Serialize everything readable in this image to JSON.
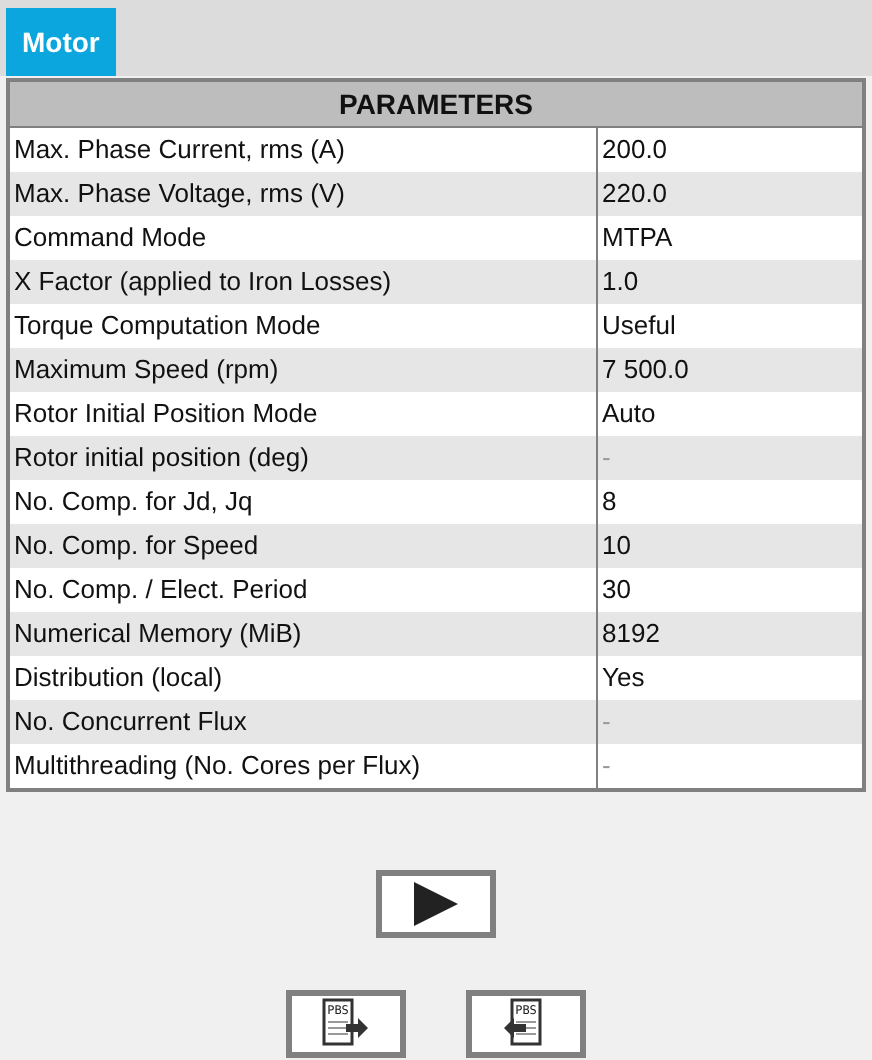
{
  "tabs": [
    {
      "label": "Motor",
      "selected": true
    }
  ],
  "table": {
    "title": "PARAMETERS",
    "rows": [
      {
        "label": "Max. Phase Current, rms (A)",
        "value": "200.0",
        "disabled": false
      },
      {
        "label": "Max. Phase Voltage, rms (V)",
        "value": "220.0",
        "disabled": false
      },
      {
        "label": "Command Mode",
        "value": "MTPA",
        "disabled": false
      },
      {
        "label": "X Factor (applied to Iron Losses)",
        "value": "1.0",
        "disabled": false
      },
      {
        "label": "Torque Computation Mode",
        "value": "Useful",
        "disabled": false
      },
      {
        "label": "Maximum Speed (rpm)",
        "value": "7 500.0",
        "disabled": false
      },
      {
        "label": "Rotor Initial Position Mode",
        "value": "Auto",
        "disabled": false
      },
      {
        "label": "Rotor initial position (deg)",
        "value": "-",
        "disabled": true
      },
      {
        "label": "No. Comp. for Jd, Jq",
        "value": "8",
        "disabled": false
      },
      {
        "label": "No. Comp. for Speed",
        "value": "10",
        "disabled": false
      },
      {
        "label": "No. Comp. / Elect. Period",
        "value": "30",
        "disabled": false
      },
      {
        "label": "Numerical Memory (MiB)",
        "value": "8192",
        "disabled": false
      },
      {
        "label": "Distribution (local)",
        "value": "Yes",
        "disabled": false
      },
      {
        "label": "No. Concurrent Flux",
        "value": "-",
        "disabled": true
      },
      {
        "label": "Multithreading (No. Cores per Flux)",
        "value": "-",
        "disabled": true
      }
    ]
  },
  "file_buttons": [
    {
      "kind": "export",
      "icon_text": "PBS"
    },
    {
      "kind": "import",
      "icon_text": "PBS"
    }
  ]
}
